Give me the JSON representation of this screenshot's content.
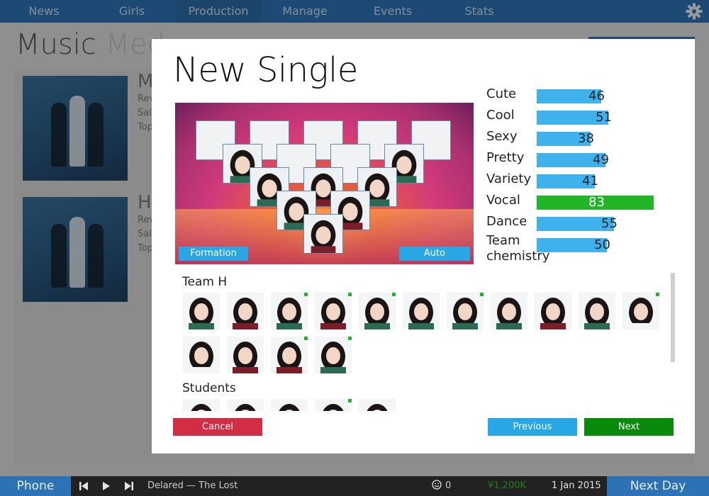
{
  "nav": {
    "tabs": [
      {
        "label": "News"
      },
      {
        "label": "Girls"
      },
      {
        "label": "Production"
      },
      {
        "label": "Manage"
      },
      {
        "label": "Events"
      },
      {
        "label": "Stats"
      }
    ],
    "active_tab": "Production",
    "settings_icon": "gear-icon"
  },
  "background": {
    "title_part1": "Music",
    "title_part2": "Med",
    "cards": [
      {
        "initial": "M",
        "lines": [
          "Rev",
          "Sal",
          "Top"
        ]
      },
      {
        "initial": "H",
        "lines": [
          "Rev",
          "Sal",
          "Top"
        ]
      }
    ]
  },
  "modal": {
    "title": "New Single",
    "formation_button": "Formation",
    "auto_button": "Auto",
    "stats": [
      {
        "label": "Cute",
        "value": 46
      },
      {
        "label": "Cool",
        "value": 51
      },
      {
        "label": "Sexy",
        "value": 38
      },
      {
        "label": "Pretty",
        "value": 49
      },
      {
        "label": "Variety",
        "value": 41
      },
      {
        "label": "Vocal",
        "value": 83,
        "highlight": true
      },
      {
        "label": "Dance",
        "value": 55
      },
      {
        "label": "Team chemistry",
        "label_line1": "Team",
        "label_line2": "chemistry",
        "value": 50
      }
    ],
    "groups": [
      {
        "name": "Team H"
      },
      {
        "name": "Students"
      }
    ],
    "cancel_button": "Cancel",
    "previous_button": "Previous",
    "next_button": "Next"
  },
  "bottom": {
    "phone": "Phone",
    "prev_icon": "skip-back-icon",
    "play_icon": "play-icon",
    "next_icon": "skip-forward-icon",
    "track": "Delared — The Lost",
    "smile_icon": "smile-icon",
    "fans": "0",
    "money": "¥1,200K",
    "date": "1 Jan 2015",
    "next_day": "Next Day"
  },
  "colors": {
    "nav_blue": "#2d72b4",
    "bar_blue": "#3fb2ee",
    "vocal_green": "#22b527",
    "cancel_red": "#d12d45",
    "next_green": "#0a8a0a",
    "button_blue": "#28a6e6"
  }
}
